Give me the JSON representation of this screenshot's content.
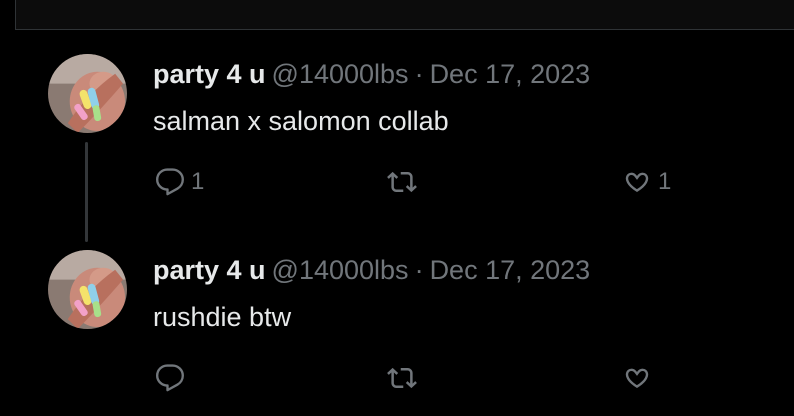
{
  "tweets": [
    {
      "author_name": "party 4 u",
      "handle": "@14000lbs",
      "separator": "·",
      "date": "Dec 17, 2023",
      "text": "salman x salomon collab",
      "reply_count": "1",
      "retweet_count": "",
      "like_count": "1"
    },
    {
      "author_name": "party 4 u",
      "handle": "@14000lbs",
      "separator": "·",
      "date": "Dec 17, 2023",
      "text": "rushdie btw",
      "reply_count": "",
      "retweet_count": "",
      "like_count": ""
    }
  ],
  "colors": {
    "background": "#000000",
    "primary_text": "#e7e9ea",
    "secondary_text": "#71767b",
    "thread_line": "#333639"
  },
  "icons": {
    "reply": "reply-icon",
    "retweet": "retweet-icon",
    "like": "heart-icon"
  }
}
